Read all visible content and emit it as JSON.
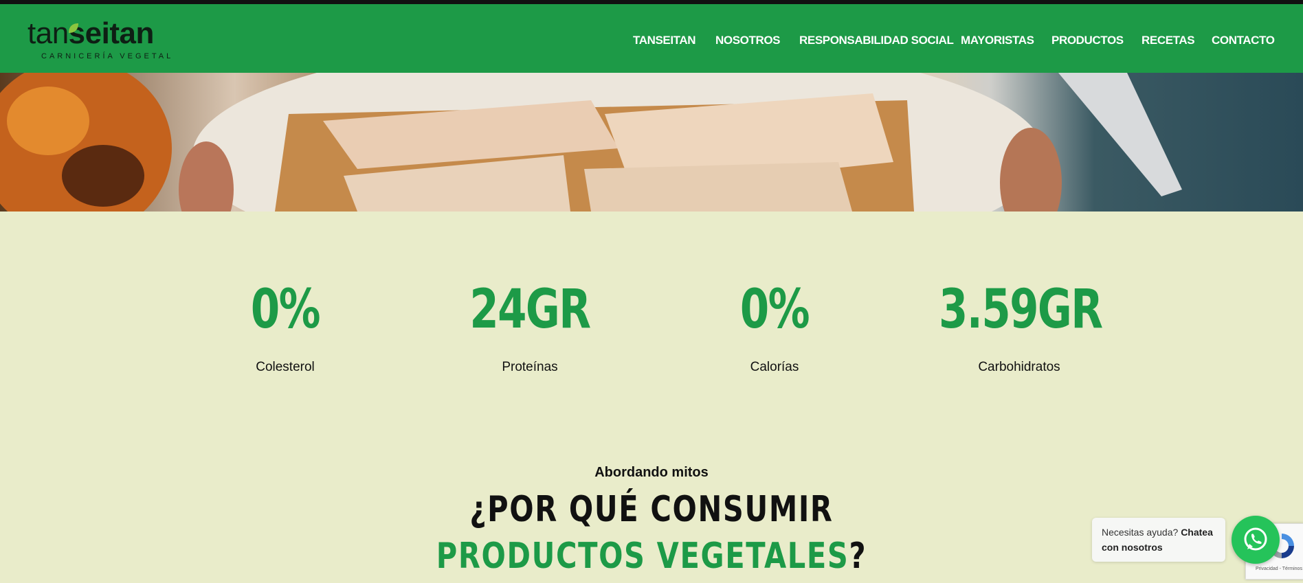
{
  "brand": {
    "logo_light": "tan",
    "logo_bold": "seitan",
    "tagline": "CARNICERÍA VEGETAL"
  },
  "nav": [
    {
      "label": "TANSEITAN"
    },
    {
      "label": "NOSOTROS"
    },
    {
      "label": "RESPONSABILIDAD SOCIAL"
    },
    {
      "label": "MAYORISTAS"
    },
    {
      "label": "PRODUCTOS"
    },
    {
      "label": "RECETAS"
    },
    {
      "label": "CONTACTO"
    }
  ],
  "stats": [
    {
      "value": "0%",
      "label": "Colesterol"
    },
    {
      "value": "24GR",
      "label": "Proteínas"
    },
    {
      "value": "0%",
      "label": "Calorías"
    },
    {
      "value": "3.59GR",
      "label": "Carbohidratos"
    }
  ],
  "section": {
    "subtitle": "Abordando mitos",
    "title_line1": "¿POR QUÉ CONSUMIR",
    "title_line2_green": "PRODUCTOS VEGETALES",
    "title_line2_end": "?"
  },
  "chat": {
    "prefix": "Necesitas ayuda? ",
    "link": "Chatea con nosotros"
  },
  "recaptcha": {
    "text": "Privacidad - Términos"
  },
  "icons": {
    "leaf": "leaf-icon",
    "whatsapp": "whatsapp-icon",
    "recaptcha": "recaptcha-icon"
  },
  "colors": {
    "brand_green": "#1d9a47",
    "page_background": "#e9ecca",
    "whatsapp_green": "#25c35a"
  }
}
